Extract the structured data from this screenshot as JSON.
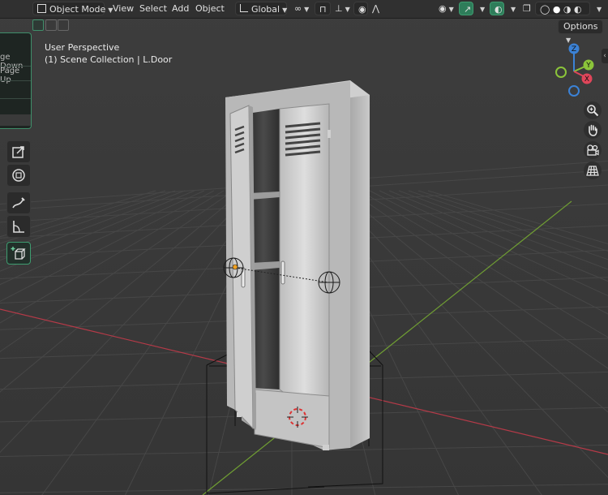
{
  "header": {
    "mode_label": "Object Mode",
    "menus": [
      "View",
      "Select",
      "Add",
      "Object"
    ],
    "orientation_label": "Global"
  },
  "side_panel": {
    "items": [
      "ge Down",
      "Page Up"
    ]
  },
  "viewport": {
    "view_name": "User Perspective",
    "collection_info": "(1) Scene Collection | L.Door",
    "options_label": "Options"
  },
  "gizmo": {
    "axis_x": "X",
    "axis_y": "Y",
    "axis_z": "Z"
  },
  "colors": {
    "accent": "#3e9c70",
    "axis_x": "#e0465a",
    "axis_y": "#8bc43a",
    "axis_z": "#3b82d6",
    "grid_x": "#c0394a",
    "grid_y": "#6aa12a"
  },
  "icons": [
    "object-mode-icon",
    "orientation-icon",
    "snap-icon",
    "proportional-edit-icon",
    "visibility-icon",
    "gizmo-icon",
    "overlay-icon",
    "xray-icon",
    "shading-solid-icon",
    "zoom-icon",
    "hand-icon",
    "camera-icon",
    "grid-icon",
    "measure-icon",
    "annotate-icon",
    "transform-icon",
    "scale-icon",
    "add-cube-icon"
  ]
}
